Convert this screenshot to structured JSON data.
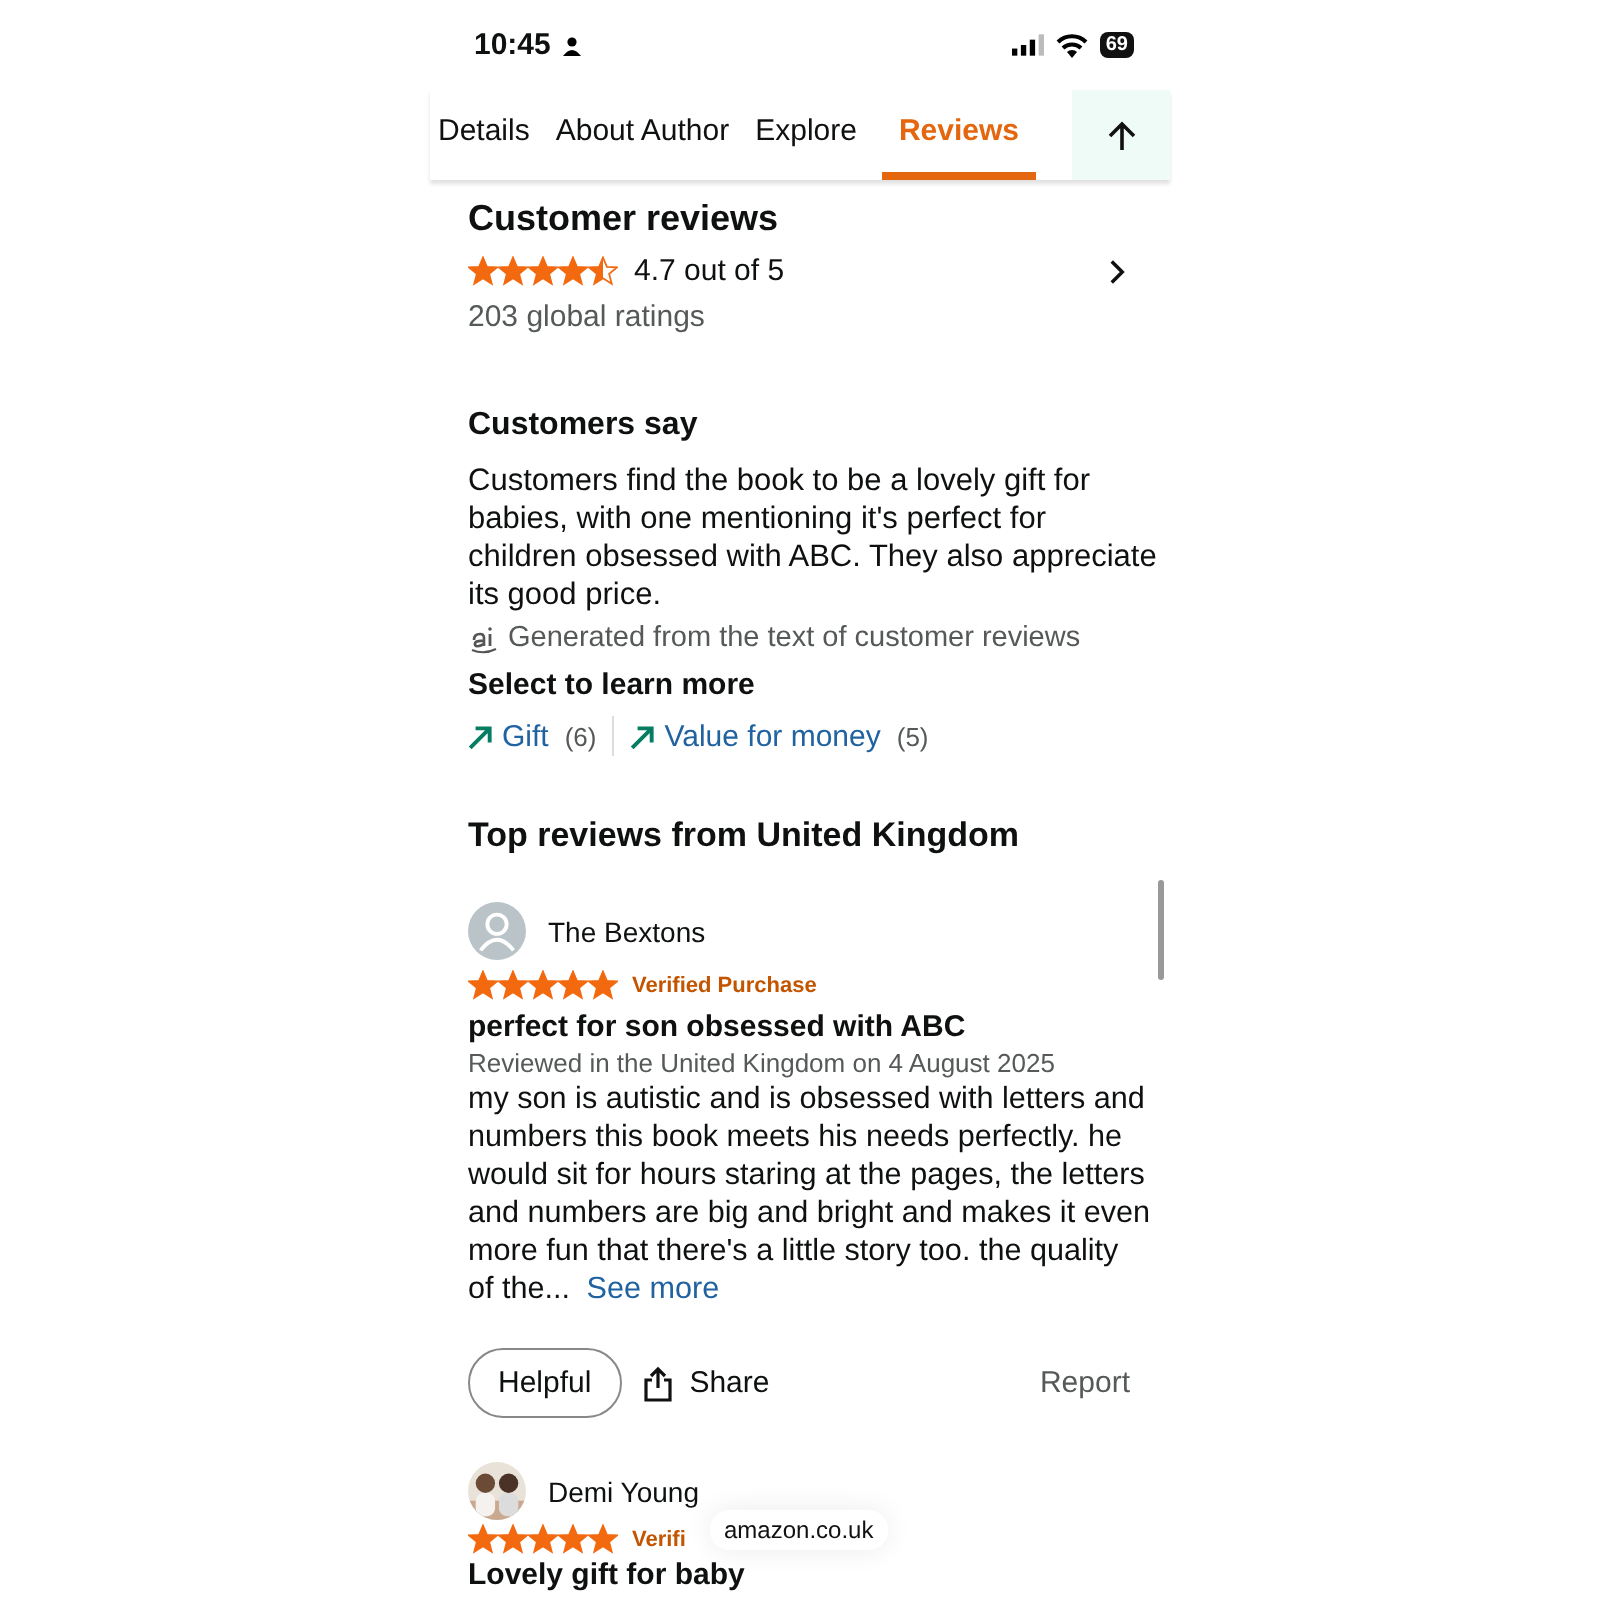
{
  "status_bar": {
    "time": "10:45",
    "battery": "69"
  },
  "tabs": [
    {
      "label": "Details",
      "selected": false
    },
    {
      "label": "About Author",
      "selected": false
    },
    {
      "label": "Explore",
      "selected": false
    },
    {
      "label": "Reviews",
      "selected": true
    }
  ],
  "summary": {
    "title": "Customer reviews",
    "stars": 4.5,
    "rating": "4.7 out of 5",
    "count": "203 global ratings"
  },
  "customers_say": {
    "title": "Customers say",
    "text": "Customers find the book to be a lovely gift for babies, with one mentioning it's perfect for children obsessed with ABC. They also appreciate its good price.",
    "ai_note": "Generated from the text of customer reviews",
    "select_label": "Select to learn more",
    "aspects": [
      {
        "label": "Gift",
        "count": "(6)"
      },
      {
        "label": "Value for money",
        "count": "(5)"
      }
    ]
  },
  "top_reviews_title": "Top reviews from United Kingdom",
  "reviews": [
    {
      "author": "The Bextons",
      "avatar": {
        "kind": "generic"
      },
      "stars": 5,
      "verified": "Verified Purchase",
      "title": "perfect for son obsessed with ABC",
      "date": "Reviewed in the United Kingdom on 4 August 2025",
      "body": "my son is autistic and is obsessed with letters and numbers this book meets his needs perfectly. he would sit for hours staring at the pages, the letters and numbers are big and bright and makes it even more fun that there's a little story too. the quality of the...",
      "see_more": "See more",
      "helpful": "Helpful",
      "share": "Share",
      "report": "Report"
    },
    {
      "author": "Demi Young",
      "stars": 5,
      "verified": "Verifi",
      "title": "Lovely gift for baby"
    }
  ],
  "url_pill": "amazon.co.uk"
}
